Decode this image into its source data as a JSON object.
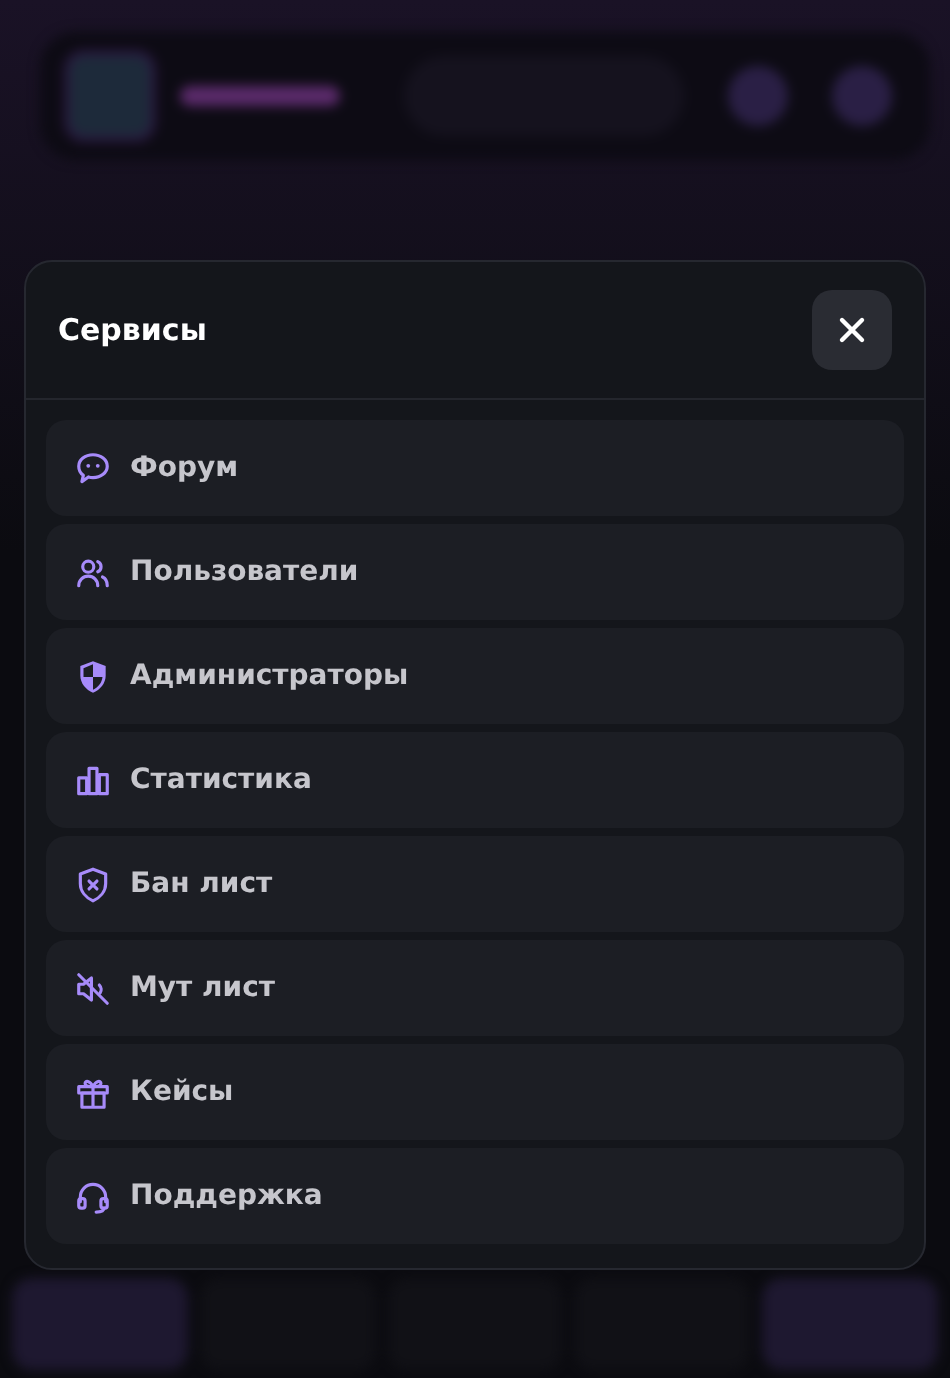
{
  "modal": {
    "title": "Сервисы",
    "items": [
      {
        "label": "Форум",
        "kind": "chat"
      },
      {
        "label": "Пользователи",
        "kind": "users"
      },
      {
        "label": "Администраторы",
        "kind": "shield"
      },
      {
        "label": "Статистика",
        "kind": "chart"
      },
      {
        "label": "Бан лист",
        "kind": "ban"
      },
      {
        "label": "Мут лист",
        "kind": "mute"
      },
      {
        "label": "Кейсы",
        "kind": "gift"
      },
      {
        "label": "Поддержка",
        "kind": "headset"
      }
    ]
  }
}
